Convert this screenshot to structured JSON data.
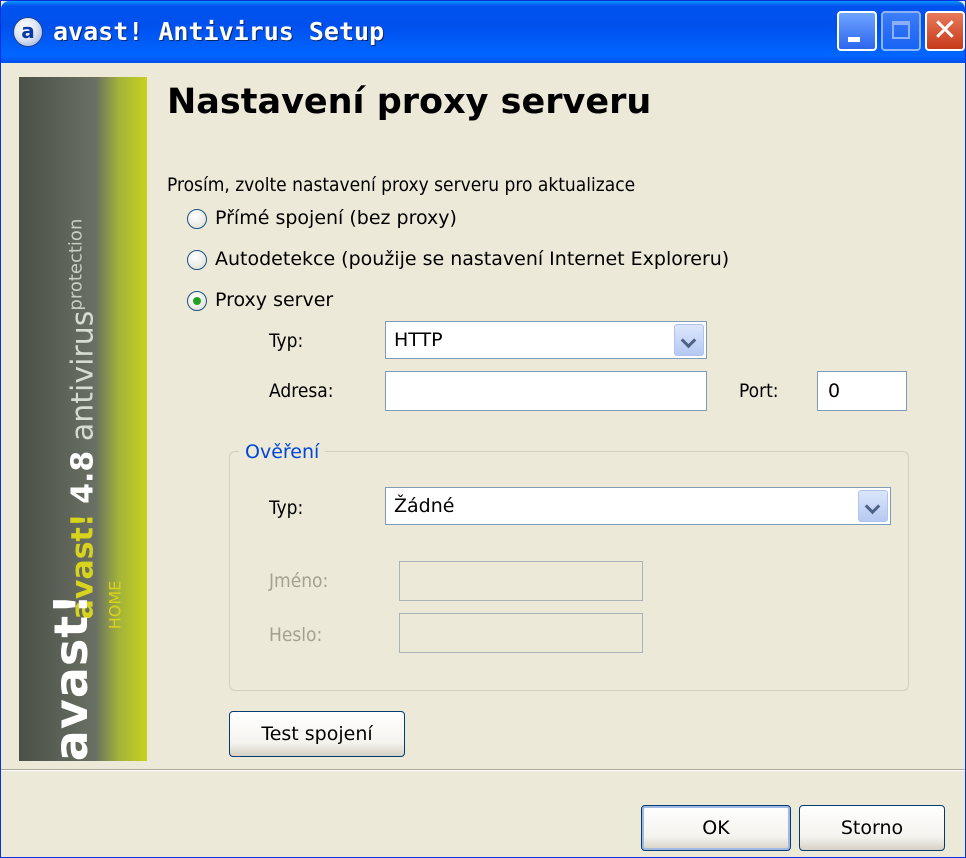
{
  "window": {
    "title": "avast! Antivirus Setup",
    "icon_letter": "a",
    "close_glyph": "✕"
  },
  "banner": {
    "brand": "avast!",
    "version": "4.8",
    "product": "antivirus",
    "tag": "protection",
    "logo": "avast!",
    "edition": "HOME"
  },
  "page": {
    "heading": "Nastavení proxy serveru",
    "prompt": "Prosím, zvolte nastavení proxy serveru pro aktualizace"
  },
  "options": [
    {
      "label": "Přímé spojení (bez proxy)",
      "checked": false
    },
    {
      "label": "Autodetekce (použije se nastavení Internet Exploreru)",
      "checked": false
    },
    {
      "label": "Proxy server",
      "checked": true
    }
  ],
  "proxy": {
    "type_label": "Typ:",
    "type_value": "HTTP",
    "address_label": "Adresa:",
    "address_value": "",
    "port_label": "Port:",
    "port_value": "0"
  },
  "auth": {
    "legend": "Ověření",
    "type_label": "Typ:",
    "type_value": "Žádné",
    "name_label": "Jméno:",
    "name_value": "",
    "password_label": "Heslo:",
    "password_value": ""
  },
  "buttons": {
    "test": "Test spojení",
    "ok": "OK",
    "cancel": "Storno"
  }
}
